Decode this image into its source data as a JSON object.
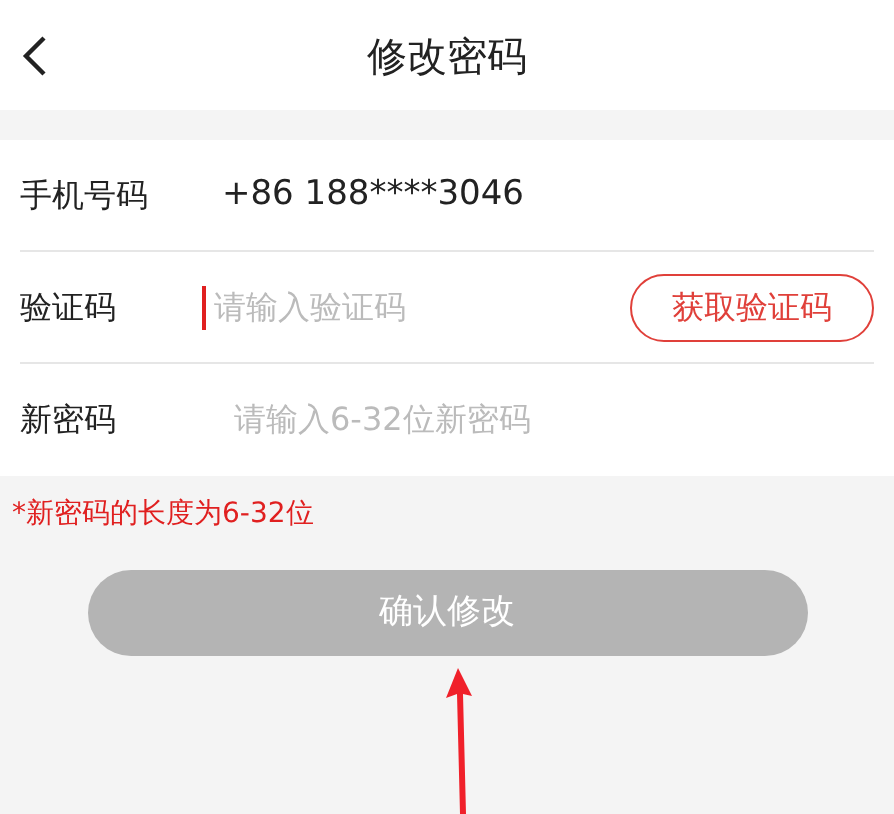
{
  "header": {
    "title": "修改密码"
  },
  "fields": [
    {
      "kind": "value",
      "label": "手机号码",
      "value": "+86 188****3046"
    },
    {
      "kind": "code",
      "label": "验证码",
      "placeholder": "请输入验证码",
      "focused": true,
      "button": "获取验证码"
    },
    {
      "kind": "password",
      "label": "新密码",
      "placeholder": "请输入6-32位新密码"
    }
  ],
  "hint": "*新密码的长度为6-32位",
  "submit": {
    "label": "确认修改",
    "disabled": true
  }
}
